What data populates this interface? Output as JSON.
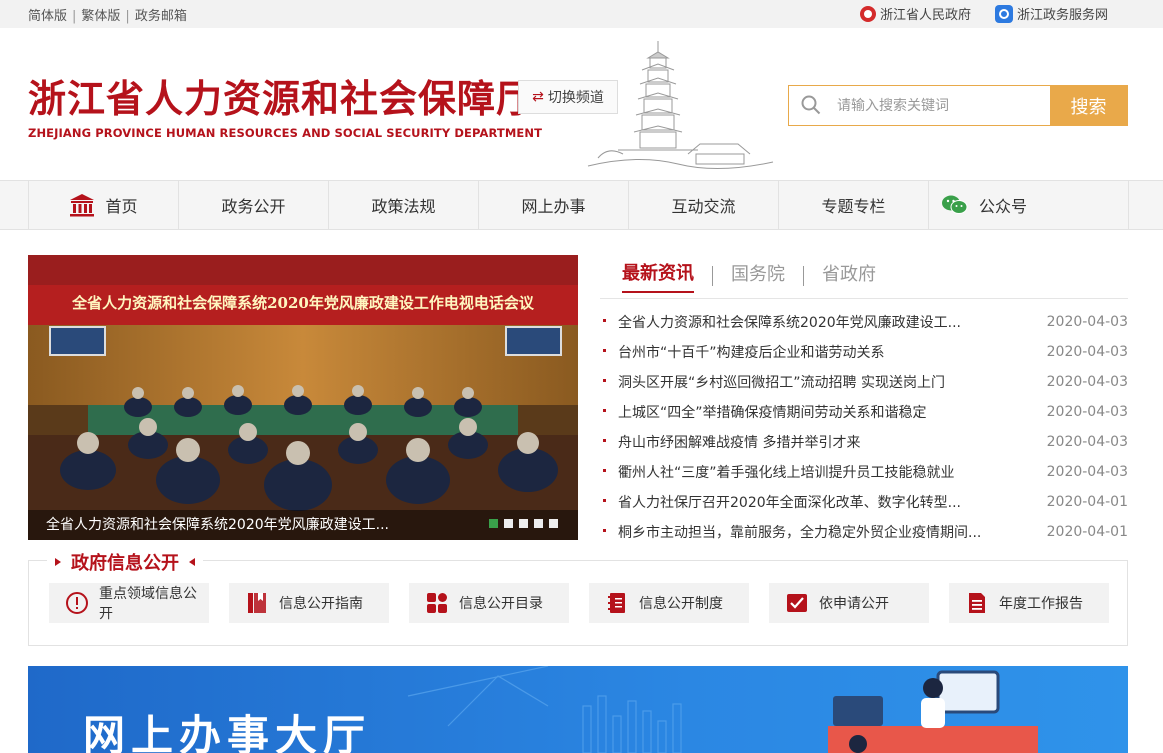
{
  "topbar": {
    "simplified": "简体版",
    "traditional": "繁体版",
    "mail": "政务邮箱",
    "gov_link": "浙江省人民政府",
    "service_link": "浙江政务服务网"
  },
  "header": {
    "title_cn": "浙江省人力资源和社会保障厅",
    "title_en": "ZHEJIANG PROVINCE HUMAN RESOURCES AND SOCIAL SECURITY DEPARTMENT",
    "switch_label": "切换频道",
    "search_placeholder": "请输入搜索关键词",
    "search_button": "搜索"
  },
  "nav": {
    "items": [
      "首页",
      "政务公开",
      "政策法规",
      "网上办事",
      "互动交流",
      "专题专栏",
      "公众号"
    ]
  },
  "slider": {
    "caption": "全省人力资源和社会保障系统2020年党风廉政建设工...",
    "banner_text": "全省人力资源和社会保障系统2020年党风廉政建设工作电视电话会议",
    "active_dot": 1,
    "dot_count": 5
  },
  "news": {
    "tabs": [
      "最新资讯",
      "国务院",
      "省政府"
    ],
    "items": [
      {
        "title": "全省人力资源和社会保障系统2020年党风廉政建设工...",
        "date": "2020-04-03"
      },
      {
        "title": "台州市“十百千”构建疫后企业和谐劳动关系",
        "date": "2020-04-03"
      },
      {
        "title": "洞头区开展“乡村巡回微招工”流动招聘 实现送岗上门",
        "date": "2020-04-03"
      },
      {
        "title": "上城区“四全”举措确保疫情期间劳动关系和谐稳定",
        "date": "2020-04-03"
      },
      {
        "title": "舟山市纾困解难战疫情 多措并举引才来",
        "date": "2020-04-03"
      },
      {
        "title": "衢州人社“三度”着手强化线上培训提升员工技能稳就业",
        "date": "2020-04-03"
      },
      {
        "title": "省人力社保厅召开2020年全面深化改革、数字化转型...",
        "date": "2020-04-01"
      },
      {
        "title": "桐乡市主动担当，靠前服务，全力稳定外贸企业疫情期间...",
        "date": "2020-04-01"
      }
    ]
  },
  "gov_info": {
    "title": "政府信息公开",
    "items": [
      "重点领域信息公开",
      "信息公开指南",
      "信息公开目录",
      "信息公开制度",
      "依申请公开",
      "年度工作报告"
    ]
  },
  "banner": {
    "title": "网上办事大厅"
  },
  "colors": {
    "brand_red": "#b5121b",
    "search_orange": "#e9a94a",
    "banner_blue": "#2b87e3"
  }
}
